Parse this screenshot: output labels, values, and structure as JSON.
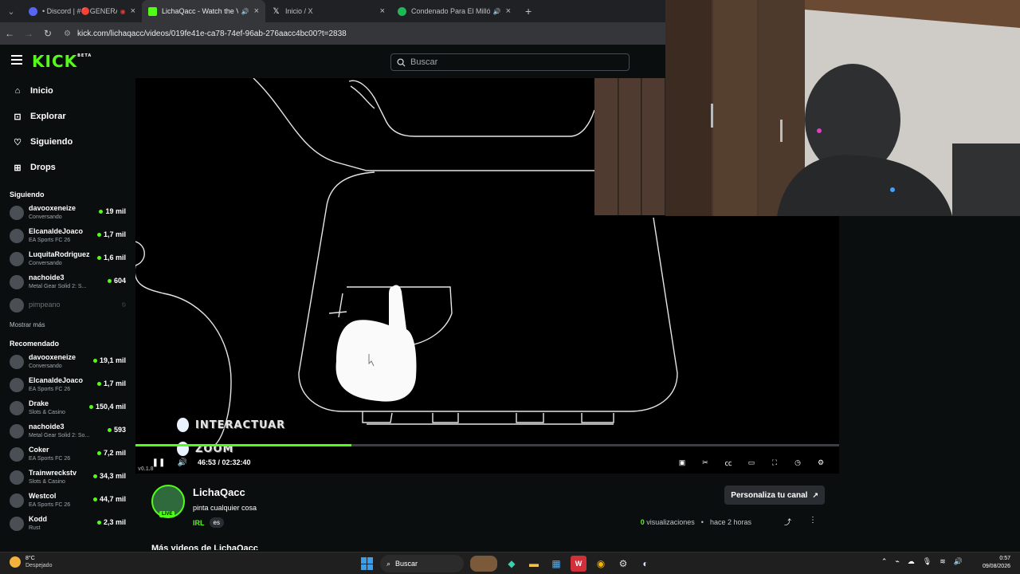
{
  "browser": {
    "tabs": [
      {
        "title": "• Discord | #🔴GENERAL |",
        "favicon_color": "#5865f2",
        "active": false
      },
      {
        "title": "LichaQacc - Watch the VOD",
        "favicon_color": "#53fc18",
        "active": true
      },
      {
        "title": "Inicio / X",
        "favicon_color": "#000000",
        "active": false
      },
      {
        "title": "Condenado Para El Millón -",
        "favicon_color": "#1db954",
        "active": false
      }
    ],
    "url": "kick.com/lichaqacc/videos/019fe41e-ca78-74ef-96ab-276aacc4bc00?t=2838"
  },
  "kick": {
    "logo": "KICK",
    "logo_badge": "BETA",
    "search_placeholder": "Buscar",
    "nav": [
      {
        "label": "Inicio",
        "icon": "home-icon"
      },
      {
        "label": "Explorar",
        "icon": "compass-icon"
      },
      {
        "label": "Siguiendo",
        "icon": "heart-icon"
      },
      {
        "label": "Drops",
        "icon": "drops-icon"
      }
    ],
    "following_title": "Siguiendo",
    "following": [
      {
        "name": "davooxeneize",
        "category": "Conversando",
        "viewers": "19 mil"
      },
      {
        "name": "ElcanaldeJoaco",
        "category": "EA Sports FC 26",
        "viewers": "1,7 mil"
      },
      {
        "name": "LuquitaRodriguez",
        "category": "Conversando",
        "viewers": "1,6 mil"
      },
      {
        "name": "nachoide3",
        "category": "Metal Gear Solid 2: S...",
        "viewers": "604"
      },
      {
        "name": "pimpeano",
        "category": "",
        "viewers": ""
      }
    ],
    "show_more": "Mostrar más",
    "recommended_title": "Recomendado",
    "recommended": [
      {
        "name": "davooxeneize",
        "category": "Conversando",
        "viewers": "19,1 mil"
      },
      {
        "name": "ElcanaldeJoaco",
        "category": "EA Sports FC 26",
        "viewers": "1,7 mil"
      },
      {
        "name": "Drake",
        "category": "Slots & Casino",
        "viewers": "150,4 mil"
      },
      {
        "name": "nachoide3",
        "category": "Metal Gear Solid 2: So...",
        "viewers": "593"
      },
      {
        "name": "Coker",
        "category": "EA Sports FC 26",
        "viewers": "7,2 mil"
      },
      {
        "name": "Trainwreckstv",
        "category": "Slots & Casino",
        "viewers": "34,3 mil"
      },
      {
        "name": "Westcol",
        "category": "EA Sports FC 26",
        "viewers": "44,7 mil"
      },
      {
        "name": "Kodd",
        "category": "Rust",
        "viewers": "2,3 mil"
      }
    ]
  },
  "player": {
    "overlay_1": "INTERACTUAR",
    "overlay_2": "ZOOM",
    "version": "v0.1.8",
    "time": "46:53 / 02:32:40",
    "progress": 0.307
  },
  "channel": {
    "name": "LichaQacc",
    "stream_title": "pinta cualquier cosa",
    "live_badge": "LIVE",
    "category": "IRL",
    "language": "es",
    "customize_label": "Personaliza tu canal",
    "views_count": "0",
    "views_label": "visualizaciones",
    "age": "hace 2 horas",
    "more_videos": "Más videos de LichaQacc"
  },
  "taskbar": {
    "temp": "8°C",
    "weather": "Despejado",
    "search": "Buscar",
    "time": "0:57",
    "date": "09/08/2026"
  }
}
